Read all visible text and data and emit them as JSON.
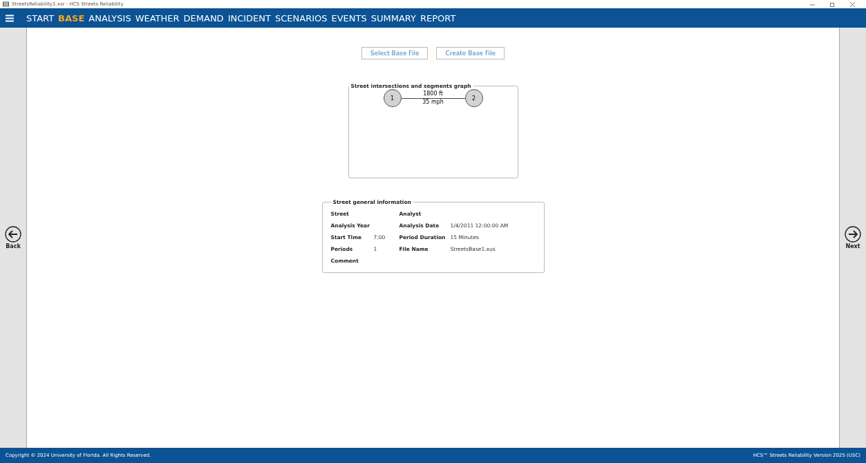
{
  "window": {
    "title": "StreetsReliability1.xsr - HCS Streets Reliability"
  },
  "menu": [
    {
      "label": "START",
      "selected": false
    },
    {
      "label": "BASE",
      "selected": true
    },
    {
      "label": "ANALYSIS",
      "selected": false
    },
    {
      "label": "WEATHER",
      "selected": false
    },
    {
      "label": "DEMAND",
      "selected": false
    },
    {
      "label": "INCIDENT",
      "selected": false
    },
    {
      "label": "SCENARIOS",
      "selected": false
    },
    {
      "label": "EVENTS",
      "selected": false
    },
    {
      "label": "SUMMARY",
      "selected": false
    },
    {
      "label": "REPORT",
      "selected": false
    }
  ],
  "buttons": [
    "Select Base File",
    "Create Base File"
  ],
  "graph": {
    "title": "Street intersections and segments graph",
    "nodes": [
      "1",
      "2"
    ],
    "segment": {
      "length": "1800 ft",
      "speed": "35 mph"
    }
  },
  "info": {
    "title": "Street general information",
    "rows": [
      [
        {
          "label": "Street"
        },
        {
          "label": "Analyst"
        }
      ],
      [
        {
          "label": "Analysis Year"
        },
        {
          "label": "Analysis Date",
          "value": "1/4/2011 12:00:00 AM"
        }
      ],
      [
        {
          "label": "Start Time",
          "value": "7:00"
        },
        {
          "label": "Period Duration",
          "value": "15 Minutes"
        }
      ],
      [
        {
          "label": "Periods",
          "value": "1"
        },
        {
          "label": "File Name",
          "value": "StreetsBase1.xus"
        }
      ],
      [
        {
          "label": "Comment"
        }
      ]
    ]
  },
  "nav": {
    "back": "Back",
    "next": "Next"
  },
  "status_bar": {
    "copyright": "Copyright © 2024 University of Florida. All Rights Reserved.",
    "version": "HCS™ Streets Reliability Version 2025 (USC)"
  }
}
